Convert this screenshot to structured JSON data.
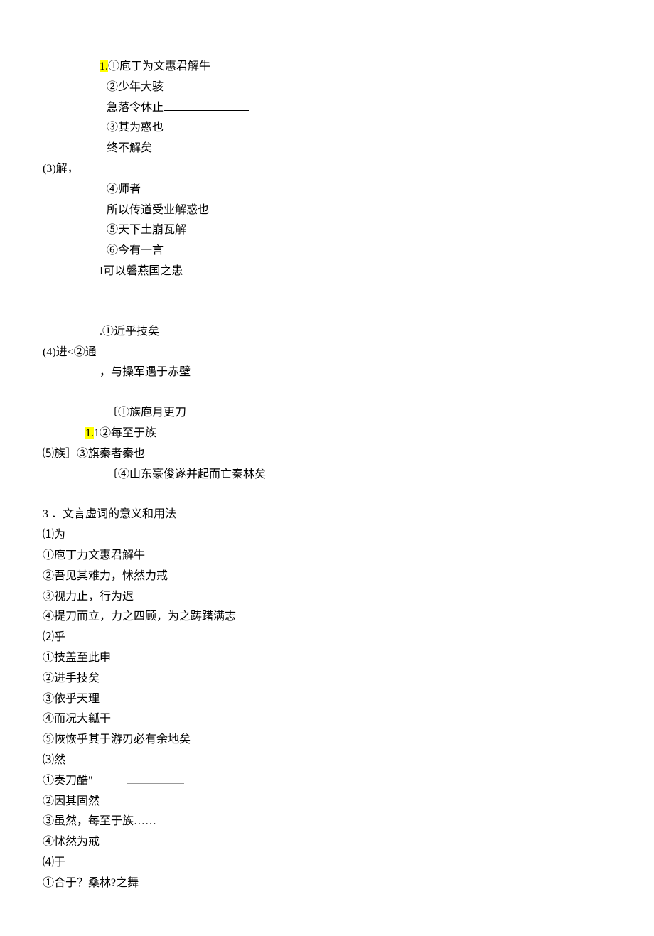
{
  "group3": {
    "label": "(3)解，",
    "hl1": "1.",
    "l1": "①庖丁为文惠君解牛",
    "l2": "②少年大骇",
    "l3": "急落令休止",
    "l4": "③其为惑也",
    "l5": "终不解矣",
    "l6": "④师者",
    "l7": "所以传道受业解惑也",
    "l8": "⑤天下土崩瓦解",
    "l9": "⑥今有一言",
    "l10": "I可以磐燕国之患"
  },
  "group4": {
    "label": "(4)进<②通",
    "l1": ".①近乎技矣",
    "l2": "，与操军遇于赤壁"
  },
  "group5": {
    "label": "⑸族］",
    "hl1": "1.",
    "l1": "〔①族庖月更刀",
    "l2a": "1②每至于族",
    "l3": "③旗秦者秦也",
    "l4": "〔④山东豪俊遂并起而亡秦林矣"
  },
  "section3": {
    "title": "3 ．文言虚词的意义和用法",
    "sub1": {
      "label": "⑴为",
      "l1": "①庖丁力文惠君解牛",
      "l2": "②吾见其难力，怵然力戒",
      "l3": "③视力止，行为迟",
      "l4": "④提刀而立，力之四顾，为之踌躇满志"
    },
    "sub2": {
      "label": "⑵乎",
      "l1": "①技盖至此申",
      "l2": "②进手技矣",
      "l3": "③依乎天理",
      "l4": "④而况大瓤干",
      "l5": "⑤恢恢乎其于游刃必有余地矣"
    },
    "sub3": {
      "label": "⑶然",
      "l1": "①奏刀酷\"",
      "l2": "②因其固然",
      "l3": "③虽然，每至于族……",
      "l4": "④怵然为戒"
    },
    "sub4": {
      "label": "⑷于",
      "l1": "①合于？桑林?之舞"
    }
  }
}
